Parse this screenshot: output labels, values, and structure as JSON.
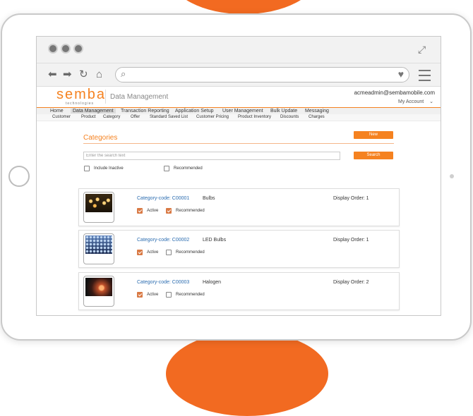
{
  "browser": {
    "address_placeholder": ""
  },
  "header": {
    "logo_word": "semba",
    "logo_sub": "technologies",
    "app_title": "Data Management",
    "user_email": "acmeadmin@sembamobile.com",
    "account_label": "My Account"
  },
  "main_menu": [
    "Home",
    "Data Management",
    "Transaction Reporting",
    "Application Setup",
    "User Management",
    "Bulk Update",
    "Messaging"
  ],
  "sub_menu": [
    "Customer",
    "Product",
    "Category",
    "Offer",
    "Standard Saved List",
    "Customer Pricing",
    "Product Inventory",
    "Discounts",
    "Charges"
  ],
  "page": {
    "title": "Categories",
    "new_button": "New",
    "search_placeholder": "Enter the search text",
    "search_button": "Search",
    "include_inactive_label": "Include Inactive",
    "recommended_label": "Recommended"
  },
  "categories": [
    {
      "code": "Category-code: C00001",
      "name": "Bulbs",
      "display_order": "Display Order: 1",
      "active": true,
      "recommended": true,
      "active_label": "Active",
      "recommended_label": "Recommended"
    },
    {
      "code": "Category-code: C00002",
      "name": "LED Bulbs",
      "display_order": "Display Order: 1",
      "active": true,
      "recommended": false,
      "active_label": "Active",
      "recommended_label": "Recommended"
    },
    {
      "code": "Category-code: C00003",
      "name": "Halogen",
      "display_order": "Display Order: 2",
      "active": true,
      "recommended": false,
      "active_label": "Active",
      "recommended_label": "Recommended"
    }
  ],
  "colors": {
    "accent": "#f58220",
    "link": "#2b6cb0",
    "checkbox_checked": "#d97a45"
  }
}
